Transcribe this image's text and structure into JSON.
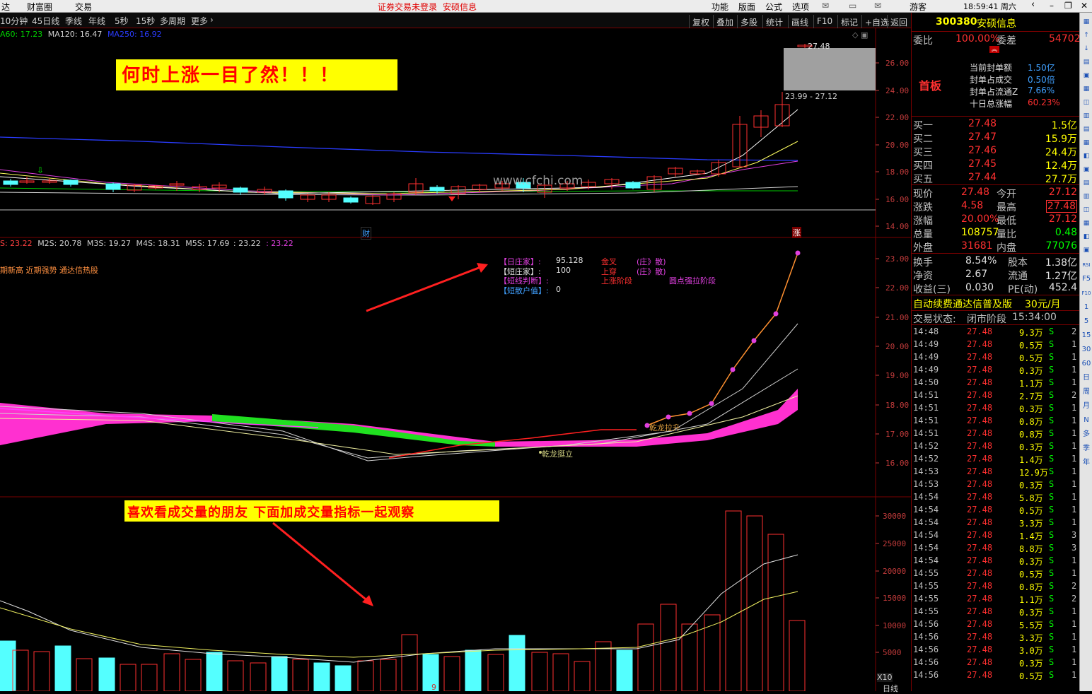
{
  "titlebar": {
    "left_items": [
      "达",
      "财富圈",
      "交易"
    ],
    "status_notice": "证券交易未登录",
    "stock_notice": "安硕信息",
    "menu": [
      "功能",
      "版面",
      "公式",
      "选项"
    ],
    "user": "游客",
    "clock": "18:59:41 周六"
  },
  "toolbar": {
    "periods": [
      "10分钟",
      "45日线",
      "季线",
      "年线",
      "5秒",
      "15秒",
      "多周期",
      "更多"
    ],
    "right_buttons": [
      "复权",
      "叠加",
      "多股",
      "统计",
      "画线",
      "F10",
      "标记",
      "+自选",
      "返回"
    ]
  },
  "main_chart": {
    "ma_legend": [
      {
        "text": "A60: 17.23",
        "color": "#00d000"
      },
      {
        "text": "MA120: 16.47",
        "color": "#d0d0d0"
      },
      {
        "text": "MA250: 16.92",
        "color": "#2a3cff"
      }
    ],
    "price_axis": [
      "26.00",
      "24.00",
      "22.00",
      "20.00",
      "18.00",
      "16.00",
      "14.00"
    ],
    "high_label": "27.48",
    "range_label": "23.99 - 27.12",
    "event_markers": [
      "财",
      "涨"
    ],
    "banner": "何时上涨一目了然！！！",
    "watermark": "www.cfchi.com"
  },
  "indicator_chart": {
    "legend": [
      {
        "text": "S: 23.22",
        "color": "#ff4040"
      },
      {
        "text": "M2S: 20.78",
        "color": "#d0d0d0"
      },
      {
        "text": "M3S: 19.27",
        "color": "#d0d0d0"
      },
      {
        "text": "M4S: 18.31",
        "color": "#d0d0d0"
      },
      {
        "text": "M5S: 17.69",
        "color": "#d0d0d0"
      },
      {
        "text": ": 23.22",
        "color": "#d0d0d0"
      },
      {
        "text": ": 23.22",
        "color": "#e040e0"
      }
    ],
    "subtitle": "期新高 近期强势 通达信热股",
    "axis": [
      "23.00",
      "22.00",
      "21.00",
      "20.00",
      "19.00",
      "18.00",
      "17.00",
      "16.00"
    ],
    "info_rows": [
      {
        "label": "【日庄家】:",
        "value": "95.128",
        "signal": "金叉",
        "state": "(庄》散)",
        "label_color": "#e040e0",
        "value_color": "#e0e0e0"
      },
      {
        "label": "【短庄家】:",
        "value": "100",
        "signal": "上穿",
        "state": "(庄》散)",
        "label_color": "#e0e0e0",
        "value_color": "#e0e0e0"
      },
      {
        "label": "【短线判断】:",
        "value": "",
        "signal": "上涨阶段",
        "state": "圆点强拉阶段",
        "label_color": "#e040e0",
        "value_color": "#e0e0e0"
      },
      {
        "label": "【短散户值】:",
        "value": "0",
        "signal": "",
        "state": "",
        "label_color": "#40a0ff",
        "value_color": "#e0e0e0"
      }
    ],
    "annot_pull": "乾龙拉升",
    "annot_stand": "乾龙挺立"
  },
  "volume_chart": {
    "banner": "喜欢看成交量的朋友  下面加成交量指标一起观察",
    "axis": [
      "30000",
      "25000",
      "20000",
      "15000",
      "10000",
      "5000"
    ],
    "unit_label": "X10",
    "period_label": "日线",
    "bottom_marker": "9"
  },
  "quote_panel": {
    "code": "300380",
    "name": "安硕信息",
    "weibi_label": "委比",
    "weibi_value": "100.00%",
    "weicha_label": "委差",
    "weicha_value": "54702",
    "board_tag": "首板",
    "seal_info": [
      {
        "label": "当前封单额",
        "value": "1.50亿"
      },
      {
        "label": "封单占成交",
        "value": "0.50倍"
      },
      {
        "label": "封单占流通Z",
        "value": "7.66%"
      },
      {
        "label": "十日总涨幅",
        "value": "60.23%"
      }
    ],
    "bids": [
      {
        "label": "买一",
        "price": "27.48",
        "vol": "1.5亿"
      },
      {
        "label": "买二",
        "price": "27.47",
        "vol": "15.9万"
      },
      {
        "label": "买三",
        "price": "27.46",
        "vol": "24.4万"
      },
      {
        "label": "买四",
        "price": "27.45",
        "vol": "12.4万"
      },
      {
        "label": "买五",
        "price": "27.44",
        "vol": "27.7万"
      }
    ],
    "stats": [
      {
        "l1": "现价",
        "v1": "27.48",
        "c1": "#ff3030",
        "l2": "今开",
        "v2": "27.12",
        "c2": "#ff3030"
      },
      {
        "l1": "涨跌",
        "v1": "4.58",
        "c1": "#ff3030",
        "l2": "最高",
        "v2": "27.48",
        "c2": "#ff3030"
      },
      {
        "l1": "涨幅",
        "v1": "20.00%",
        "c1": "#ff3030",
        "l2": "最低",
        "v2": "27.12",
        "c2": "#ff3030"
      },
      {
        "l1": "总量",
        "v1": "108757",
        "c1": "#ffff00",
        "l2": "量比",
        "v2": "0.48",
        "c2": "#00ff00"
      },
      {
        "l1": "外盘",
        "v1": "31681",
        "c1": "#ff3030",
        "l2": "内盘",
        "v2": "77076",
        "c2": "#00ff00"
      }
    ],
    "stats2": [
      {
        "l1": "换手",
        "v1": "8.54%",
        "l2": "股本",
        "v2": "1.38亿"
      },
      {
        "l1": "净资",
        "v1": "2.67",
        "l2": "流通",
        "v2": "1.27亿"
      },
      {
        "l1": "收益(三)",
        "v1": "0.030",
        "l2": "PE(动)",
        "v2": "452.4"
      }
    ],
    "promo": "自动续费通达信普及版",
    "promo_price": "30元/月",
    "trade_state_label": "交易状态:",
    "trade_state": "闭市阶段",
    "trade_time": "15:34:00",
    "ticks": [
      {
        "t": "14:48",
        "p": "27.48",
        "v": "9.3万",
        "s": "S",
        "n": "2"
      },
      {
        "t": "14:49",
        "p": "27.48",
        "v": "0.5万",
        "s": "S",
        "n": "1"
      },
      {
        "t": "14:49",
        "p": "27.48",
        "v": "0.5万",
        "s": "S",
        "n": "1"
      },
      {
        "t": "14:49",
        "p": "27.48",
        "v": "0.3万",
        "s": "S",
        "n": "1"
      },
      {
        "t": "14:50",
        "p": "27.48",
        "v": "1.1万",
        "s": "S",
        "n": "1"
      },
      {
        "t": "14:51",
        "p": "27.48",
        "v": "2.7万",
        "s": "S",
        "n": "2"
      },
      {
        "t": "14:51",
        "p": "27.48",
        "v": "0.3万",
        "s": "S",
        "n": "1"
      },
      {
        "t": "14:51",
        "p": "27.48",
        "v": "0.8万",
        "s": "S",
        "n": "1"
      },
      {
        "t": "14:51",
        "p": "27.48",
        "v": "0.8万",
        "s": "S",
        "n": "1"
      },
      {
        "t": "14:52",
        "p": "27.48",
        "v": "0.3万",
        "s": "S",
        "n": "1"
      },
      {
        "t": "14:52",
        "p": "27.48",
        "v": "1.4万",
        "s": "S",
        "n": "1"
      },
      {
        "t": "14:53",
        "p": "27.48",
        "v": "12.9万",
        "s": "S",
        "n": "1"
      },
      {
        "t": "14:53",
        "p": "27.48",
        "v": "0.3万",
        "s": "S",
        "n": "1"
      },
      {
        "t": "14:54",
        "p": "27.48",
        "v": "5.8万",
        "s": "S",
        "n": "1"
      },
      {
        "t": "14:54",
        "p": "27.48",
        "v": "0.5万",
        "s": "S",
        "n": "1"
      },
      {
        "t": "14:54",
        "p": "27.48",
        "v": "3.3万",
        "s": "S",
        "n": "1"
      },
      {
        "t": "14:54",
        "p": "27.48",
        "v": "1.4万",
        "s": "S",
        "n": "3"
      },
      {
        "t": "14:54",
        "p": "27.48",
        "v": "8.8万",
        "s": "S",
        "n": "3"
      },
      {
        "t": "14:54",
        "p": "27.48",
        "v": "0.3万",
        "s": "S",
        "n": "1"
      },
      {
        "t": "14:55",
        "p": "27.48",
        "v": "0.5万",
        "s": "S",
        "n": "1"
      },
      {
        "t": "14:55",
        "p": "27.48",
        "v": "0.8万",
        "s": "S",
        "n": "2"
      },
      {
        "t": "14:55",
        "p": "27.48",
        "v": "1.1万",
        "s": "S",
        "n": "2"
      },
      {
        "t": "14:55",
        "p": "27.48",
        "v": "0.3万",
        "s": "S",
        "n": "1"
      },
      {
        "t": "14:56",
        "p": "27.48",
        "v": "5.5万",
        "s": "S",
        "n": "1"
      },
      {
        "t": "14:56",
        "p": "27.48",
        "v": "3.3万",
        "s": "S",
        "n": "1"
      },
      {
        "t": "14:56",
        "p": "27.48",
        "v": "3.0万",
        "s": "S",
        "n": "1"
      },
      {
        "t": "14:56",
        "p": "27.48",
        "v": "0.3万",
        "s": "S",
        "n": "1"
      },
      {
        "t": "14:56",
        "p": "27.48",
        "v": "0.5万",
        "s": "S",
        "n": "1"
      }
    ]
  },
  "side_tools": [
    "RSI",
    "F5",
    "F10",
    "1",
    "5",
    "15",
    "30",
    "60",
    "日",
    "周",
    "月",
    "N",
    "多",
    "季",
    "年"
  ],
  "colors": {
    "up": "#ff3030",
    "down": "#54ffff",
    "panel_border": "#7a0000",
    "ma250": "#2a3cff",
    "banner_bg": "#ffff00",
    "banner_text": "#ff0000"
  }
}
